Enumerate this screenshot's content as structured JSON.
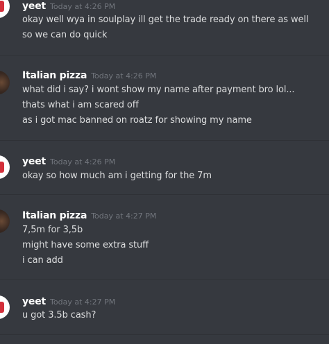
{
  "messages": [
    {
      "username": "yeet",
      "timestamp": "Today at 4:26 PM",
      "lines": [
        "okay well wya in soulplay ill get the trade ready on there as well",
        "so we can do quick"
      ]
    },
    {
      "username": "Italian pizza",
      "timestamp": "Today at 4:26 PM",
      "lines": [
        "what did i say? i wont show my name after payment bro lol...",
        "thats what i am scared off",
        "as i got mac banned on roatz for showing my name"
      ]
    },
    {
      "username": "yeet",
      "timestamp": "Today at 4:26 PM",
      "lines": [
        "okay so how much am i getting for the 7m"
      ]
    },
    {
      "username": "Italian pizza",
      "timestamp": "Today at 4:27 PM",
      "lines": [
        "7,5m for 3,5b",
        "might have some extra stuff",
        "i can add"
      ]
    },
    {
      "username": "yeet",
      "timestamp": "Today at 4:27 PM",
      "lines": [
        "u got 3.5b cash?"
      ]
    }
  ]
}
